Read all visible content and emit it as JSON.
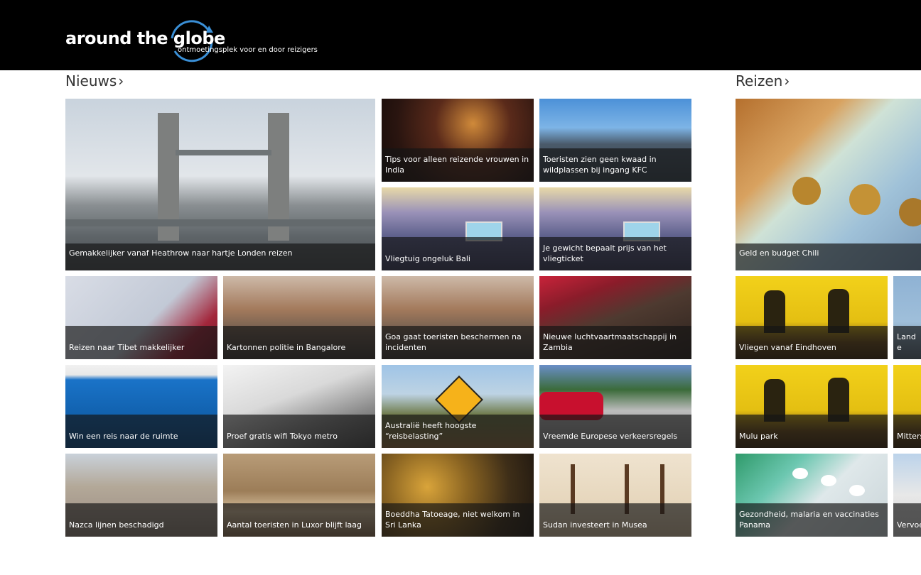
{
  "header": {
    "logo_title": "around the globe",
    "logo_tagline": "ontmoetingsplek voor en door reizigers"
  },
  "sections": {
    "nieuws": {
      "label": "Nieuws",
      "chevron": "›"
    },
    "reizen": {
      "label": "Reizen",
      "chevron": "›"
    }
  },
  "nieuws": {
    "tiles": [
      "Gemakkelijker vanaf Heathrow naar hartje Londen reizen",
      "Tips voor alleen reizende vrouwen in India",
      "Toeristen zien geen kwaad in wildplassen bij ingang KFC",
      "Vliegtuig ongeluk Bali",
      "Je gewicht bepaalt prijs van het vliegticket",
      "Reizen naar Tibet makkelijker",
      "Kartonnen politie in Bangalore",
      "Goa gaat toeristen beschermen na incidenten",
      "Nieuwe luchtvaartmaatschappij in Zambia",
      "Win een reis naar de ruimte",
      "Proef gratis wifi Tokyo metro",
      "Australië heeft hoogste “reisbelasting”",
      "Vreemde Europese verkeersregels",
      "Nazca lijnen beschadigd",
      "Aantal toeristen in Luxor blijft laag",
      "Boeddha Tatoeage, niet welkom in Sri Lanka",
      "Sudan investeert in Musea"
    ]
  },
  "reizen": {
    "tiles": [
      "Geld en budget Chili",
      "Vliegen vanaf Eindhoven",
      "Land e",
      "Mulu park",
      "Mitters",
      "Gezondheid, malaria en vaccinaties Panama",
      "Vervoe"
    ]
  },
  "colors": {
    "topbar": "#000000",
    "logo_accent": "#3a8fd6",
    "caption_bg": "rgba(20,20,20,0.68)",
    "page_bg": "#ffffff"
  }
}
